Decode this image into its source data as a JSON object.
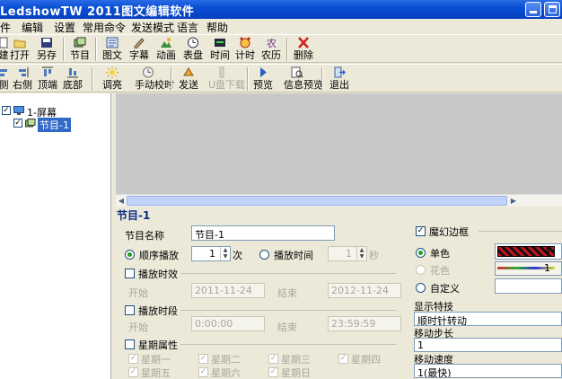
{
  "window": {
    "title": "LedshowTW 2011图文编辑软件"
  },
  "menu": [
    "件",
    "编辑",
    "设置",
    "常用命令",
    "发送模式",
    "语言",
    "帮助"
  ],
  "toolbar1": [
    {
      "label": "建",
      "icon": "new-icon"
    },
    {
      "label": "打开",
      "icon": "open-icon"
    },
    {
      "label": "另存",
      "icon": "save-icon"
    },
    {
      "label": "节目",
      "icon": "program-icon"
    },
    {
      "label": "图文",
      "icon": "picture-text-icon"
    },
    {
      "label": "字幕",
      "icon": "subtitle-icon"
    },
    {
      "label": "动画",
      "icon": "animation-icon"
    },
    {
      "label": "表盘",
      "icon": "clock-dial-icon"
    },
    {
      "label": "时间",
      "icon": "time-icon"
    },
    {
      "label": "计时",
      "icon": "alarm-clock-icon"
    },
    {
      "label": "农历",
      "icon": "lunar-calendar-icon"
    },
    {
      "label": "删除",
      "icon": "delete-icon"
    }
  ],
  "toolbar2": [
    {
      "label": "侧",
      "icon": "align-left-icon"
    },
    {
      "label": "右侧",
      "icon": "align-right-icon"
    },
    {
      "label": "顶端",
      "icon": "align-top-icon"
    },
    {
      "label": "底部",
      "icon": "align-bottom-icon"
    },
    {
      "label": "调亮",
      "icon": "brightness-icon"
    },
    {
      "label": "手动校时",
      "icon": "manual-time-icon"
    },
    {
      "label": "发送",
      "icon": "send-icon"
    },
    {
      "label": "U盘下载",
      "icon": "usb-download-icon",
      "disabled": true
    },
    {
      "label": "预览",
      "icon": "preview-icon"
    },
    {
      "label": "信息预览",
      "icon": "info-preview-icon"
    },
    {
      "label": "退出",
      "icon": "exit-icon"
    }
  ],
  "tree": {
    "screen": "1-屏幕",
    "program": "节目-1"
  },
  "panel": {
    "title": "节目-1",
    "name_label": "节目名称",
    "name_value": "节目-1",
    "seq_play_label": "顺序播放",
    "seq_count": "1",
    "seq_unit": "次",
    "time_play_label": "播放时间",
    "time_value": "1",
    "time_unit": "秒",
    "effect_label": "播放时效",
    "start_label": "开始",
    "start_date": "2011-11-24",
    "end_label": "结束",
    "end_date": "2012-11-24",
    "period_label": "播放时段",
    "period_start_label": "开始",
    "period_start": "0:00:00",
    "period_end_label": "结束",
    "period_end": "23:59:59",
    "weekday_label": "星期属性",
    "weekdays": [
      "星期一",
      "星期二",
      "星期三",
      "星期四",
      "星期五",
      "星期六",
      "星期日"
    ]
  },
  "border": {
    "magic_border_label": "魔幻边框",
    "mono_label": "单色",
    "mono_value": "4",
    "multi_label": "花色",
    "multi_value": "1",
    "custom_label": "自定义",
    "effect_label": "显示特技",
    "effect_value": "顺时针转动",
    "step_label": "移动步长",
    "step_value": "1",
    "speed_label": "移动速度",
    "speed_value": "1(最快)"
  },
  "colors": {
    "title_bar": "#0a4fd4",
    "selection": "#316ac5",
    "preview_bg": "#c8c8c8",
    "panel_title": "#0a2d8c"
  }
}
